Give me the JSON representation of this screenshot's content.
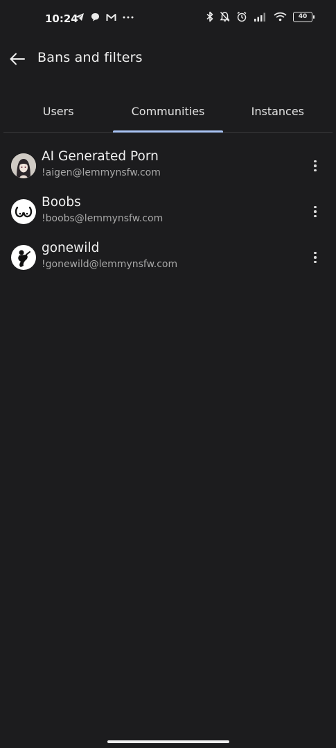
{
  "status_bar": {
    "time": "10:24",
    "left_icons": [
      "telegram-icon",
      "chat-bubble-icon",
      "gmail-icon",
      "more-dots-icon"
    ],
    "right_icons": [
      "bluetooth-icon",
      "bell-muted-icon",
      "alarm-icon",
      "signal-icon",
      "wifi-icon"
    ],
    "battery": "40"
  },
  "app_bar": {
    "title": "Bans and filters",
    "back_icon": "arrow-back-icon"
  },
  "tabs": [
    {
      "label": "Users",
      "selected": false
    },
    {
      "label": "Communities",
      "selected": true
    },
    {
      "label": "Instances",
      "selected": false
    }
  ],
  "accent_color": "#a9c4f5",
  "communities": [
    {
      "name": "AI Generated Porn",
      "handle": "!aigen@lemmynsfw.com",
      "avatar": "anime-girl-avatar"
    },
    {
      "name": "Boobs",
      "handle": "!boobs@lemmynsfw.com",
      "avatar": "boobs-glyph-avatar"
    },
    {
      "name": "gonewild",
      "handle": "!gonewild@lemmynsfw.com",
      "avatar": "silhouette-avatar"
    }
  ]
}
